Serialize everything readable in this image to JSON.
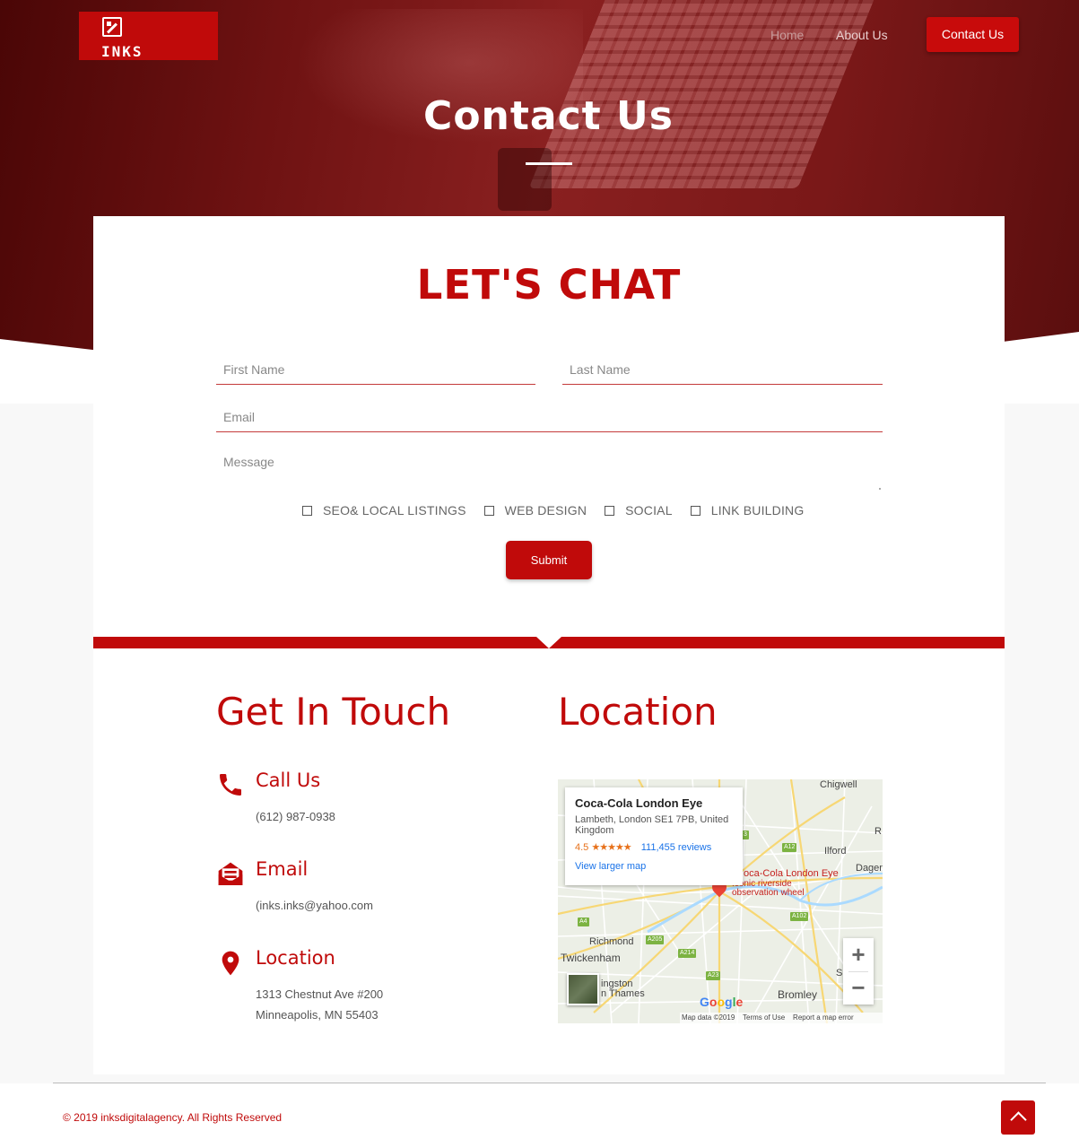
{
  "brand": {
    "logo_text": "INKS"
  },
  "nav": {
    "home": "Home",
    "about": "About Us",
    "contact": "Contact Us"
  },
  "hero": {
    "title": "Contact Us"
  },
  "form": {
    "title": "LET'S CHAT",
    "first_name_placeholder": "First Name",
    "last_name_placeholder": "Last Name",
    "email_placeholder": "Email",
    "message_placeholder": "Message",
    "services": [
      "SEO& LOCAL LISTINGS",
      "WEB DESIGN",
      "SOCIAL",
      "LINK BUILDING"
    ],
    "submit_label": "Submit"
  },
  "contact": {
    "heading": "Get In Touch",
    "call_title": "Call Us",
    "phone": "(612) 987-0938",
    "email_title": "Email",
    "email": "(inks.inks@yahoo.com",
    "location_title": "Location",
    "address_line1": "1313 Chestnut Ave #200",
    "address_line2": "Minneapolis, MN 55403"
  },
  "location": {
    "heading": "Location",
    "map": {
      "place_name": "Coca-Cola London Eye",
      "address": "Lambeth, London SE1 7PB, United Kingdom",
      "rating": "4.5",
      "stars": "★★★★★",
      "reviews": "111,455 reviews",
      "view_larger": "View larger map",
      "pin_label": "oca-Cola London Eye",
      "pin_sub1": "Iconic riverside",
      "pin_sub2": "observation wheel",
      "labels": {
        "chigwell": "Chigwell",
        "ilford": "Ilford",
        "dagen": "Dagen",
        "richmond": "Richmond",
        "twickenham": "Twickenham",
        "kingston1": "ingston",
        "kingston2": "n Thames",
        "bromley": "Bromley",
        "r": "R",
        "s": "S"
      },
      "roads": {
        "a12": "A12",
        "a4": "A4",
        "a205": "A205",
        "a214": "A214",
        "a23": "A23",
        "a102": "A102",
        "a3": "3"
      },
      "google": "Google",
      "map_data": "Map data ©2019",
      "terms": "Terms of Use",
      "report": "Report a map error"
    }
  },
  "footer": {
    "copyright": "© 2019 inksdigitalagency. All Rights Reserved"
  },
  "colors": {
    "brand_red": "#c00a0a",
    "hero_overlay": "#7a1818"
  },
  "icons": {
    "phone": "phone-icon",
    "email": "envelope-icon",
    "location": "map-pin-icon",
    "to_top": "chevron-up-icon"
  }
}
